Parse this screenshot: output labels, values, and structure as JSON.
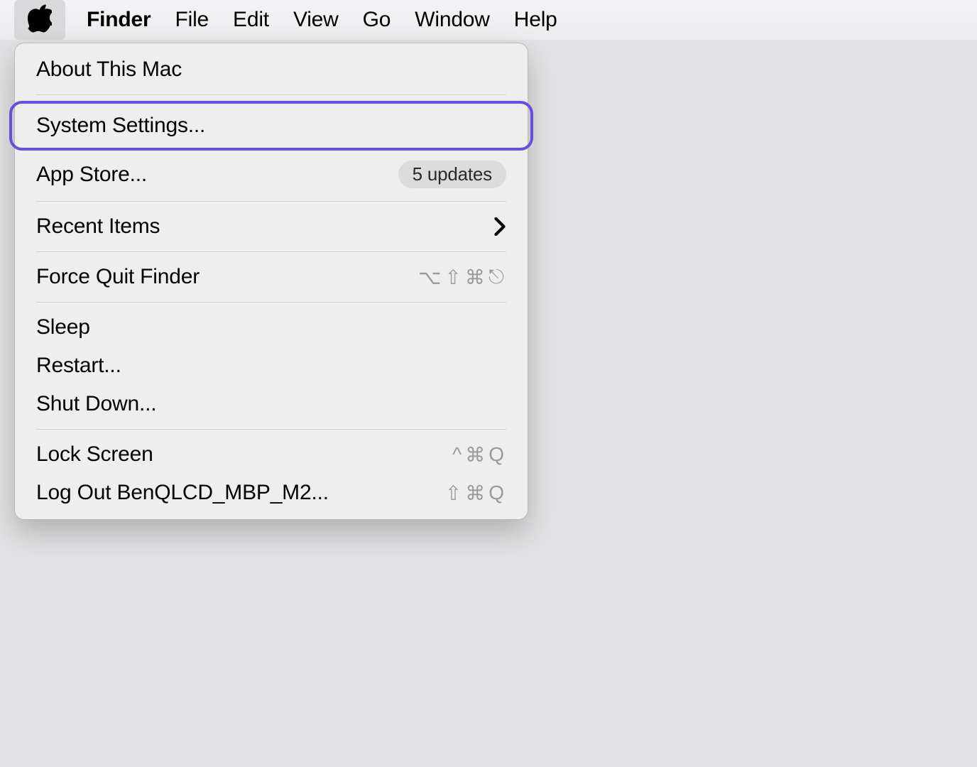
{
  "menubar": {
    "app_name": "Finder",
    "items": [
      "File",
      "Edit",
      "View",
      "Go",
      "Window",
      "Help"
    ]
  },
  "apple_menu": {
    "about": "About This Mac",
    "system_settings": "System Settings...",
    "app_store": "App Store...",
    "app_store_badge": "5 updates",
    "recent_items": "Recent Items",
    "force_quit": "Force Quit Finder",
    "force_quit_shortcut": "⌥⇧⌘⎋",
    "sleep": "Sleep",
    "restart": "Restart...",
    "shut_down": "Shut Down...",
    "lock_screen": "Lock Screen",
    "lock_screen_shortcut": "^⌘Q",
    "log_out": "Log Out BenQLCD_MBP_M2...",
    "log_out_shortcut": "⇧⌘Q"
  }
}
